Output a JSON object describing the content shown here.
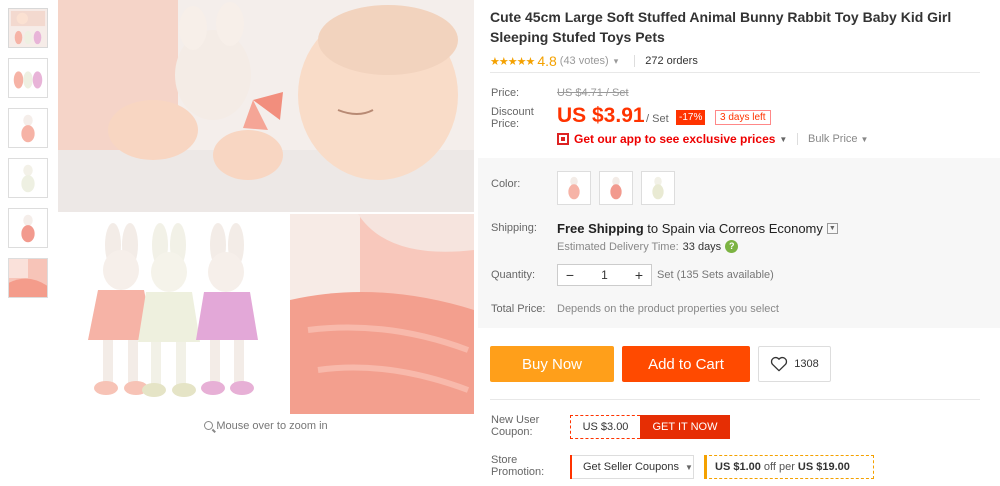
{
  "gallery": {
    "zoom_hint": "Mouse over to zoom in",
    "thumbnail_count": 6
  },
  "product": {
    "title": "Cute 45cm Large Soft Stuffed Animal Bunny Rabbit Toy Baby Kid Girl Sleeping Stufed Toys Pets",
    "stars": "★★★★★",
    "rating": "4.8",
    "votes": "(43 votes)",
    "orders": "272 orders"
  },
  "price": {
    "label": "Price:",
    "old_price": "US $4.71 / Set",
    "discount_label_1": "Discount",
    "discount_label_2": "Price:",
    "current_price": "US $3.91",
    "unit": "/ Set",
    "discount_badge": "-17%",
    "days_left": "3 days left",
    "app_promo": "Get our app to see exclusive prices",
    "bulk_price": "Bulk Price"
  },
  "options": {
    "color_label": "Color:",
    "color_count": 3,
    "shipping_label": "Shipping:",
    "shipping_free": "Free Shipping",
    "shipping_to": "to Spain via Correos Economy",
    "delivery_label": "Estimated Delivery Time:",
    "delivery_days": "33 days",
    "quantity_label": "Quantity:",
    "quantity_minus": "−",
    "quantity_value": "1",
    "quantity_plus": "+",
    "quantity_available": "Set (135 Sets available)",
    "total_label": "Total Price:",
    "total_value": "Depends on the product properties you select"
  },
  "actions": {
    "buy_now": "Buy Now",
    "add_to_cart": "Add to Cart",
    "wishlist_count": "1308"
  },
  "coupons": {
    "new_user_label_1": "New User",
    "new_user_label_2": "Coupon:",
    "coupon_amount": "US $3.00",
    "get_it_now": "GET IT NOW",
    "store_label_1": "Store",
    "store_label_2": "Promotion:",
    "seller_coupons": "Get Seller Coupons",
    "deal_off": "US $1.00",
    "deal_mid": "off per",
    "deal_threshold": "US $19.00"
  },
  "colors": {
    "accent_orange": "#ff4a00",
    "buy_orange": "#ff9f1a",
    "price_red": "#ff3300",
    "star_gold": "#f4a100"
  }
}
